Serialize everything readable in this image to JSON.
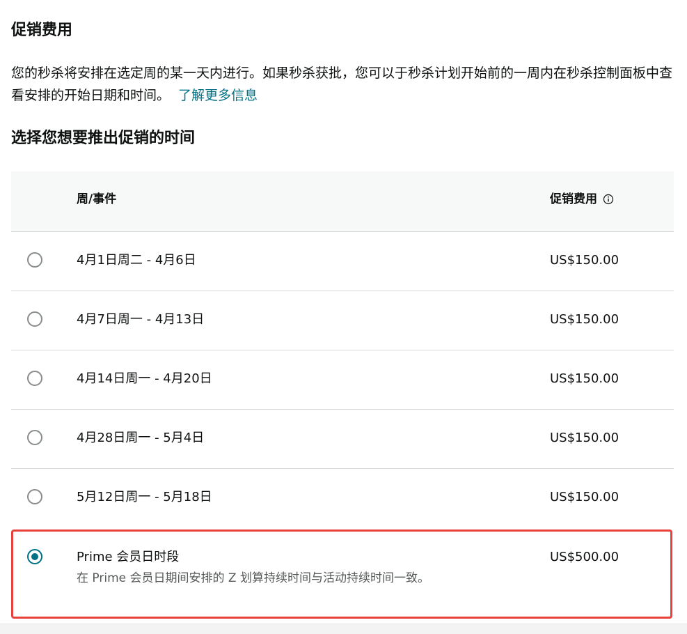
{
  "section": {
    "title": "促销费用",
    "description": "您的秒杀将安排在选定周的某一天内进行。如果秒杀获批，您可以于秒杀计划开始前的一周内在秒杀控制面板中查看安排的开始日期和时间。",
    "learn_more": "了解更多信息"
  },
  "schedule": {
    "title": "选择您想要推出促销的时间",
    "columns": {
      "week": "周/事件",
      "fee": "促销费用",
      "fee_icon": "info-icon"
    },
    "rows": [
      {
        "label": "4月1日周二 - 4月6日",
        "price": "US$150.00",
        "selected": false
      },
      {
        "label": "4月7日周一 - 4月13日",
        "price": "US$150.00",
        "selected": false
      },
      {
        "label": "4月14日周一 - 4月20日",
        "price": "US$150.00",
        "selected": false
      },
      {
        "label": "4月28日周一 - 5月4日",
        "price": "US$150.00",
        "selected": false
      },
      {
        "label": "5月12日周一 - 5月18日",
        "price": "US$150.00",
        "selected": false
      }
    ],
    "prime_row": {
      "label": "Prime 会员日时段",
      "sublabel": "在 Prime 会员日期间安排的 Z 划算持续时间与活动持续时间一致。",
      "price": "US$500.00",
      "selected": true
    }
  },
  "colors": {
    "accent": "#007185",
    "highlight_border": "#e8413b",
    "header_bg": "#f7f8f8",
    "divider": "#d5d9d9"
  }
}
